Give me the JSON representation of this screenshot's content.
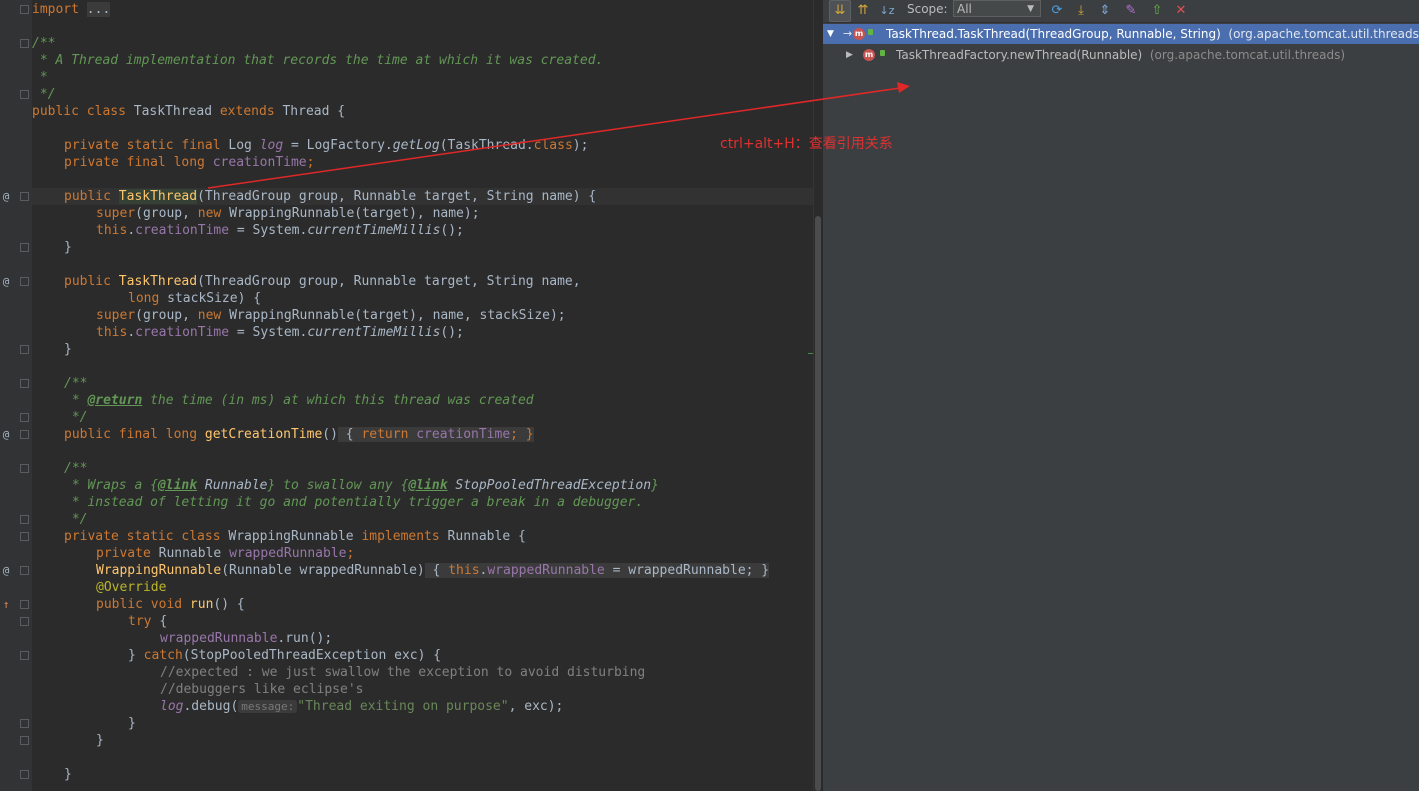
{
  "editor": {
    "lines": {
      "l1a": "import",
      "l1b": "...",
      "l3": "/**",
      "l4": " * A Thread implementation that records the time at which it was created.",
      "l5": " *",
      "l6": " */",
      "l7a": "public class",
      "l7b": "TaskThread",
      "l7c": "extends",
      "l7d": "Thread {",
      "l9a": "private static final",
      "l9b": "Log",
      "l9c": "log",
      "l9d": "= LogFactory.",
      "l9e": "getLog",
      "l9f": "(TaskThread.",
      "l9g": "class",
      "l9h": ");",
      "l10a": "private final long",
      "l10b": "creationTime",
      "l10c": ";",
      "l12a": "public",
      "l12b": "TaskThread",
      "l12c": "(ThreadGroup group, Runnable target, String name) {",
      "l13a": "super",
      "l13b": "(group,",
      "l13c": "new",
      "l13d": "WrappingRunnable(target), name);",
      "l14a": "this",
      "l14b": ".",
      "l14c": "creationTime",
      "l14d": "= System.",
      "l14e": "currentTimeMillis",
      "l14f": "();",
      "l15": "}",
      "l17a": "public",
      "l17b": "TaskThread",
      "l17c": "(ThreadGroup group, Runnable target, String name,",
      "l18a": "long",
      "l18b": "stackSize) {",
      "l19a": "super",
      "l19b": "(group,",
      "l19c": "new",
      "l19d": "WrappingRunnable(target), name, stackSize);",
      "l20a": "this",
      "l20b": ".",
      "l20c": "creationTime",
      "l20d": "= System.",
      "l20e": "currentTimeMillis",
      "l20f": "();",
      "l21": "}",
      "l23": "/**",
      "l24a": " * ",
      "l24b": "@return",
      "l24c": " the time (in ms) at which this thread was created",
      "l25": " */",
      "l26a": "public final long",
      "l26b": "getCreationTime",
      "l26c": "()",
      "l26d": " {",
      "l26e": "return",
      "l26f": "creationTime",
      "l26g": "; }",
      "l28": "/**",
      "l29a": " * Wraps a {",
      "l29b": "@link",
      "l29c": " Runnable",
      "l29d": "} to swallow any {",
      "l29e": "@link",
      "l29f": " StopPooledThreadException",
      "l29g": "}",
      "l30": " * instead of letting it go and potentially trigger a break in a debugger.",
      "l31": " */",
      "l32a": "private static class",
      "l32b": "WrappingRunnable",
      "l32c": "implements",
      "l32d": "Runnable {",
      "l33a": "private",
      "l33b": "Runnable",
      "l33c": "wrappedRunnable",
      "l33d": ";",
      "l34a": "WrappingRunnable",
      "l34b": "(Runnable wrappedRunnable)",
      "l34c": " {",
      "l34d": "this",
      "l34e": ".",
      "l34f": "wrappedRunnable",
      "l34g": "= wrappedRunnable;",
      "l34h": " }",
      "l35": "@Override",
      "l36a": "public void",
      "l36b": "run",
      "l36c": "() {",
      "l37a": "try",
      "l37b": "{",
      "l38a": "wrappedRunnable",
      "l38b": ".run();",
      "l39a": "}",
      "l39b": "catch",
      "l39c": "(StopPooledThreadException exc) {",
      "l40": "//expected : we just swallow the exception to avoid disturbing",
      "l41": "//debuggers like eclipse's",
      "l42a": "log",
      "l42b": ".debug(",
      "l42c": "message:",
      "l42d": "\"Thread exiting on purpose\"",
      "l42e": ", exc);",
      "l43": "}",
      "l44": "}",
      "l46": "}"
    }
  },
  "toolbar": {
    "scope_label": "Scope:",
    "scope_value": "All",
    "icons": [
      "caller-hierarchy-icon",
      "callee-hierarchy-icon",
      "sort-alpha-icon",
      "refresh-icon",
      "autoscroll-to-source-icon",
      "expand-all-icon",
      "pin-icon",
      "export-icon",
      "close-icon"
    ]
  },
  "tree": {
    "rows": [
      {
        "method": "TaskThread.TaskThread(ThreadGroup, Runnable, String)",
        "package": "(org.apache.tomcat.util.threads)"
      },
      {
        "method": "TaskThreadFactory.newThread(Runnable)",
        "package": "(org.apache.tomcat.util.threads)"
      }
    ]
  },
  "annotation": {
    "text": "ctrl+alt+H：查看引用关系",
    "color": "#e03030"
  },
  "colors": {
    "editor_bg": "#2b2b2b",
    "panel_bg": "#3c3f41",
    "selection": "#4b6eaf",
    "keyword": "#cc7832",
    "field": "#9876aa",
    "string": "#6a8759",
    "doc": "#629755",
    "method": "#ffc66d"
  }
}
